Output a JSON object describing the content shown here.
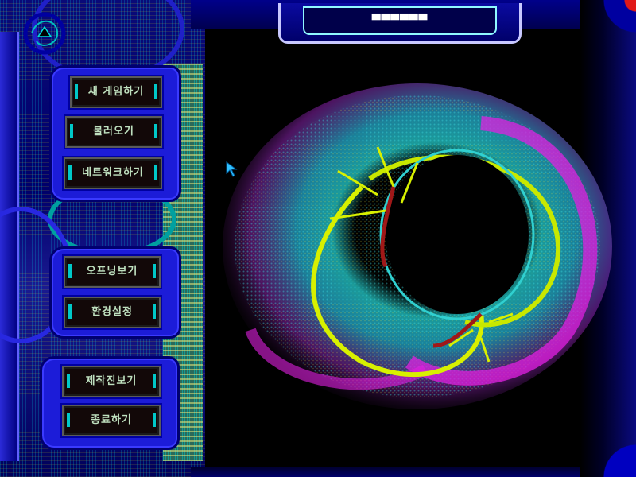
{
  "title": {
    "text": "▀▀▀▀▀▀"
  },
  "menu": {
    "group1": [
      {
        "id": "new-game",
        "label": "새 게임하기"
      },
      {
        "id": "load",
        "label": "불러오기"
      },
      {
        "id": "network",
        "label": "네트워크하기"
      }
    ],
    "group2": [
      {
        "id": "view-intro",
        "label": "오프닝보기"
      },
      {
        "id": "options",
        "label": "환경설정"
      }
    ],
    "group3": [
      {
        "id": "credits",
        "label": "제작진보기"
      },
      {
        "id": "quit",
        "label": "종료하기"
      }
    ]
  },
  "colors": {
    "frame_blue": "#1c1cd8",
    "frame_dark": "#000070",
    "button_bg": "#120808",
    "accent_cyan": "#00c8c8",
    "accent_magenta": "#e020e0",
    "accent_yellow": "#e8f000",
    "accent_red": "#e01818"
  },
  "icons": [
    "logo-emblem-icon",
    "cursor-arrow-icon"
  ]
}
